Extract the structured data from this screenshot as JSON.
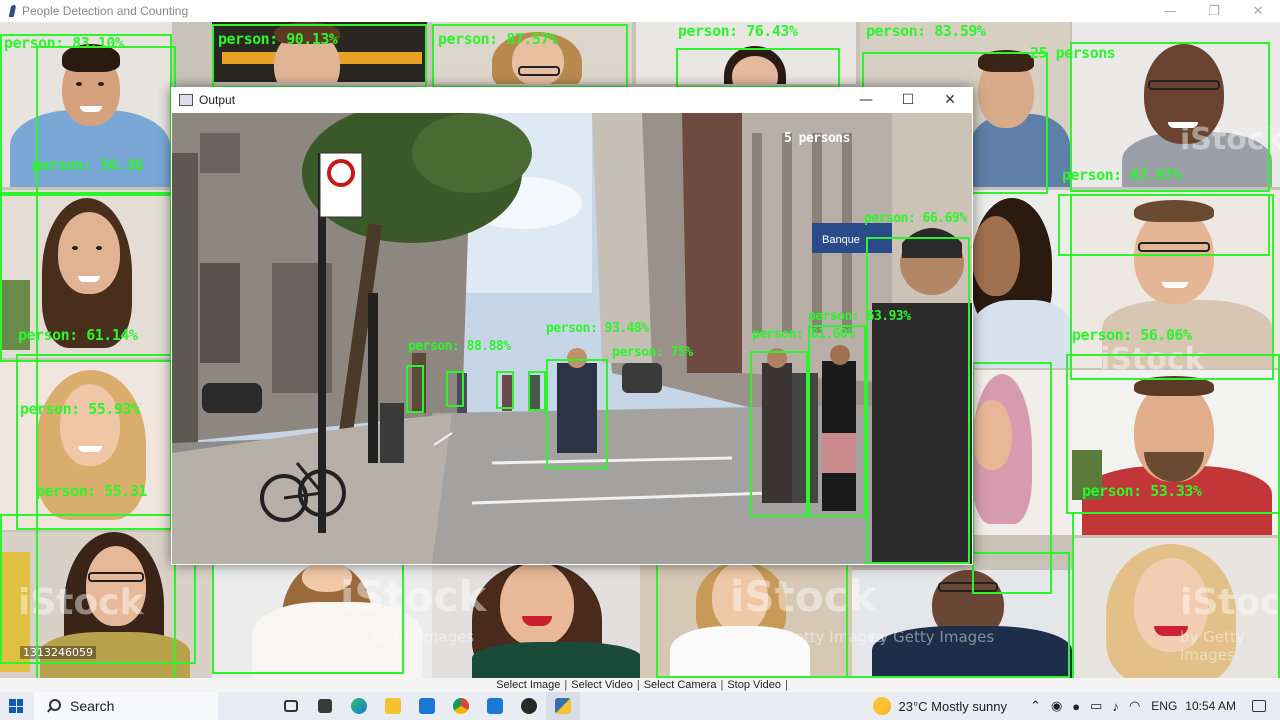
{
  "window": {
    "title": "People Detection and Counting",
    "minimize": "—",
    "maximize": "❐",
    "close": "✕"
  },
  "mosaic_labels": [
    "person: 83.10%",
    "person: 90.13%",
    "person: 87.57%",
    "person: 76.43%",
    "person: 83.59%",
    "person: 56.36",
    "person: 67.97%",
    "25 persons",
    "person: 61.14%",
    "person: 56.06%",
    "person: 55.93%",
    "person: 55.31",
    "person: 53.33%"
  ],
  "watermarks": {
    "istock": "iStock",
    "getty": "by Getty Images",
    "image_id": "1313246059"
  },
  "output_window": {
    "title": "Output",
    "minimize": "—",
    "maximize": "☐",
    "close": "✕",
    "count_label": "5 persons",
    "street_labels": [
      "person: 63.93%",
      "person: 93.48%",
      "person: 81.60%",
      "person: 88.88%",
      "person: 75%",
      "person: 66.69%"
    ],
    "sign_text": "Banque"
  },
  "buttons": {
    "select_image": "Select Image",
    "select_video": "Select Video",
    "select_camera": "Select Camera",
    "stop_video": "Stop Video",
    "separator": "|"
  },
  "taskbar": {
    "search_label": "Search",
    "weather": "23°C  Mostly sunny",
    "language": "ENG",
    "time": "10:54 AM"
  }
}
